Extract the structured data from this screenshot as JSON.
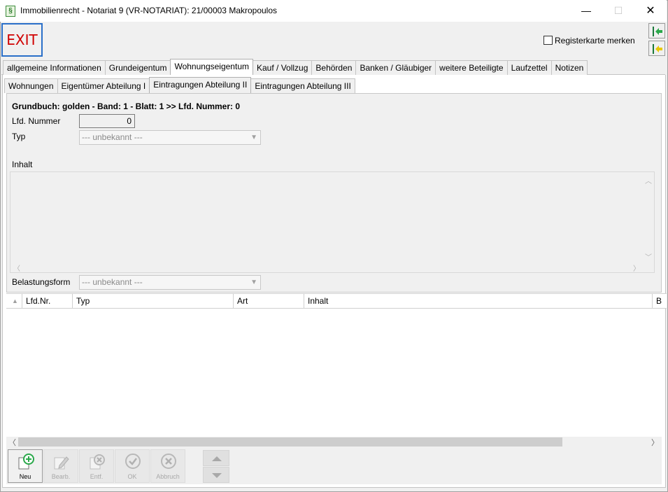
{
  "window": {
    "title": "Immobilienrecht - Notariat 9 (VR-NOTARIAT): 21/00003 Makropoulos",
    "app_icon": "§",
    "minimize": "—",
    "maximize": "☐",
    "close": "✕"
  },
  "toolbar": {
    "exit_label": "EXIT",
    "remember_label": "Registerkarte merken",
    "remember_checked": false
  },
  "main_tabs": [
    {
      "label": "allgemeine Informationen",
      "active": false
    },
    {
      "label": "Grundeigentum",
      "active": false
    },
    {
      "label": "Wohnungseigentum",
      "active": true
    },
    {
      "label": "Kauf / Vollzug",
      "active": false
    },
    {
      "label": "Behörden",
      "active": false
    },
    {
      "label": "Banken / Gläubiger",
      "active": false
    },
    {
      "label": "weitere Beteiligte",
      "active": false
    },
    {
      "label": "Laufzettel",
      "active": false
    },
    {
      "label": "Notizen",
      "active": false
    }
  ],
  "sub_tabs": [
    {
      "label": "Wohnungen",
      "active": false
    },
    {
      "label": "Eigentümer Abteilung I",
      "active": false
    },
    {
      "label": "Eintragungen Abteilung II",
      "active": true
    },
    {
      "label": "Eintragungen Abteilung III",
      "active": false
    }
  ],
  "form": {
    "grundbuch_header": "Grundbuch: golden - Band: 1 - Blatt: 1 >> Lfd. Nummer: 0",
    "lfd_nummer_label": "Lfd. Nummer",
    "lfd_nummer_value": "0",
    "typ_label": "Typ",
    "typ_value": "--- unbekannt ---",
    "inhalt_label": "Inhalt",
    "inhalt_value": "",
    "belastungsform_label": "Belastungsform",
    "belastungsform_value": "--- unbekannt ---"
  },
  "grid": {
    "sort_glyph": "▲",
    "columns": [
      "Lfd.Nr.",
      "Typ",
      "Art",
      "Inhalt",
      "B"
    ],
    "rows": []
  },
  "buttons": {
    "neu": "Neu",
    "bearb": "Bearb.",
    "entf": "Entf.",
    "ok": "OK",
    "abbruch": "Abbruch"
  }
}
